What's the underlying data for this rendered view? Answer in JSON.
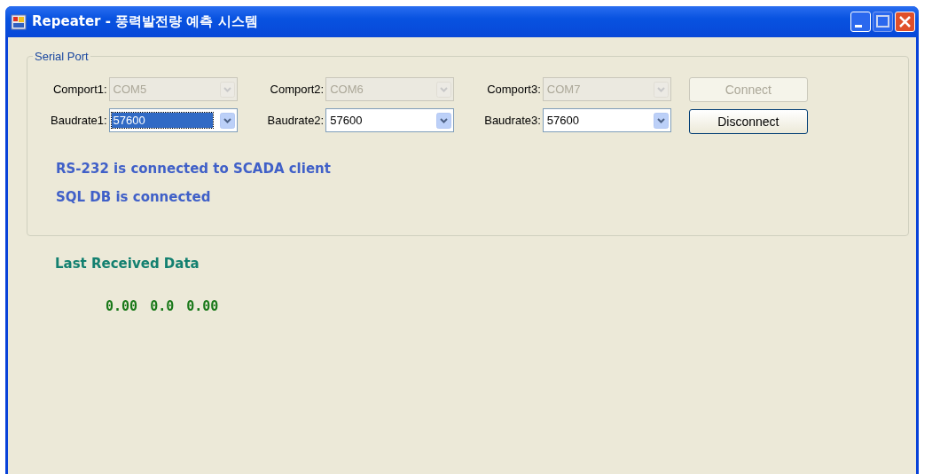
{
  "window": {
    "title": "Repeater - 풍력발전량 예측 시스템"
  },
  "serial_port": {
    "title": "Serial Port",
    "columns": [
      {
        "comport": {
          "label": "Comport1:",
          "value": "COM5",
          "disabled": true,
          "selected": false
        },
        "baudrate": {
          "label": "Baudrate1:",
          "value": "57600",
          "disabled": false,
          "selected": true
        }
      },
      {
        "comport": {
          "label": "Comport2:",
          "value": "COM6",
          "disabled": true,
          "selected": false
        },
        "baudrate": {
          "label": "Baudrate2:",
          "value": "57600",
          "disabled": false,
          "selected": false
        }
      },
      {
        "comport": {
          "label": "Comport3:",
          "value": "COM7",
          "disabled": true,
          "selected": false
        },
        "baudrate": {
          "label": "Baudrate3:",
          "value": "57600",
          "disabled": false,
          "selected": false
        }
      }
    ],
    "buttons": [
      {
        "label": "Connect",
        "disabled": true
      },
      {
        "label": "Disconnect",
        "disabled": false
      }
    ],
    "status_lines": [
      "RS-232 is connected to SCADA client",
      "SQL DB is connected"
    ]
  },
  "last_received": {
    "title": "Last Received Data",
    "values": [
      "0.00",
      "0.0",
      "0.00"
    ]
  }
}
